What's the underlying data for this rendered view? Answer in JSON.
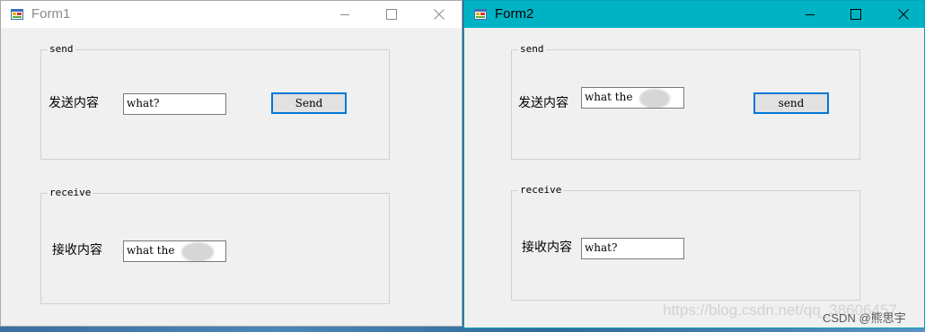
{
  "form1": {
    "title": "Form1",
    "icons": {
      "app": "winforms-app-icon",
      "minimize": "minimize-icon",
      "maximize": "maximize-icon",
      "close": "close-icon"
    },
    "send_group": {
      "legend": "send",
      "label": "发送内容",
      "input_value": "what?",
      "button_label": "Send"
    },
    "receive_group": {
      "legend": "receive",
      "label": "接收内容",
      "input_value": "what the"
    }
  },
  "form2": {
    "title": "Form2",
    "icons": {
      "app": "winforms-app-icon",
      "minimize": "minimize-icon",
      "maximize": "maximize-icon",
      "close": "close-icon"
    },
    "send_group": {
      "legend": "send",
      "label": "发送内容",
      "input_value": "what the",
      "button_label": "send"
    },
    "receive_group": {
      "legend": "receive",
      "label": "接收内容",
      "input_value": "what?"
    }
  },
  "watermark": {
    "url_text": "https://blog.csdn.net/qq_38606457",
    "csdn_text": "CSDN @熊思宇"
  },
  "colors": {
    "form2_titlebar": "#00b3c4",
    "button_focus_border": "#0078d7",
    "form_background": "#f0f0f0"
  }
}
